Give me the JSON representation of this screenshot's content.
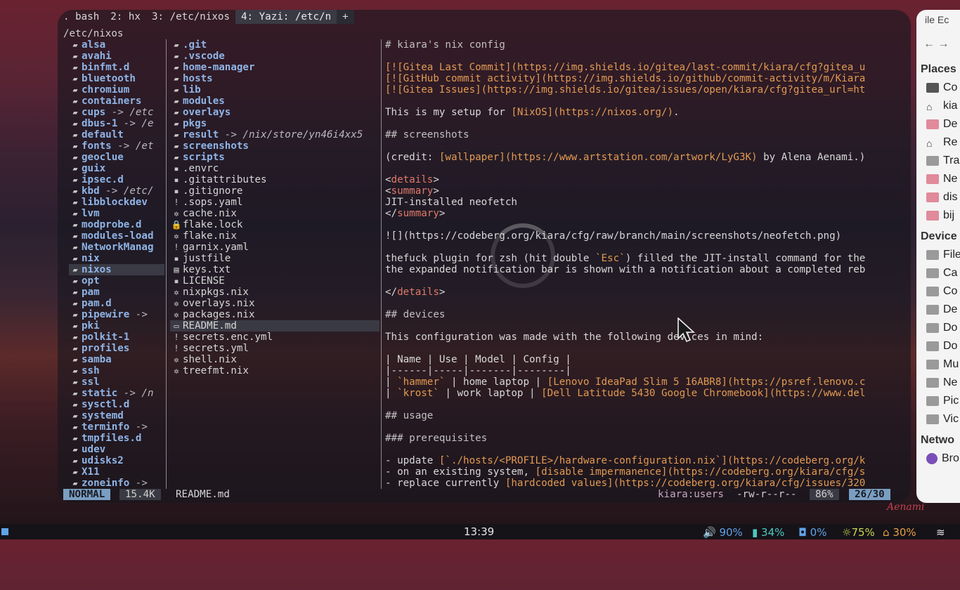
{
  "tabs": [
    {
      "label": ". bash"
    },
    {
      "label": "2: hx"
    },
    {
      "label": "3: /etc/nixos"
    },
    {
      "label": "4: Yazi: /etc/n"
    },
    {
      "label": "+"
    }
  ],
  "cwd": "/etc/nixos",
  "parent_entries": [
    {
      "name": "alsa",
      "type": "dir"
    },
    {
      "name": "avahi",
      "type": "dir"
    },
    {
      "name": "binfmt.d",
      "type": "dir"
    },
    {
      "name": "bluetooth",
      "type": "dir"
    },
    {
      "name": "chromium",
      "type": "dir"
    },
    {
      "name": "containers",
      "type": "dir"
    },
    {
      "name": "cups",
      "type": "link",
      "target": "-> /etc"
    },
    {
      "name": "dbus-1",
      "type": "link",
      "target": "-> /e"
    },
    {
      "name": "default",
      "type": "dir"
    },
    {
      "name": "fonts",
      "type": "link",
      "target": "-> /et"
    },
    {
      "name": "geoclue",
      "type": "dir"
    },
    {
      "name": "guix",
      "type": "dir"
    },
    {
      "name": "ipsec.d",
      "type": "dir"
    },
    {
      "name": "kbd",
      "type": "link",
      "target": "-> /etc/"
    },
    {
      "name": "libblockdev",
      "type": "dir"
    },
    {
      "name": "lvm",
      "type": "dir"
    },
    {
      "name": "modprobe.d",
      "type": "dir"
    },
    {
      "name": "modules-load",
      "type": "dir"
    },
    {
      "name": "NetworkManag",
      "type": "dir"
    },
    {
      "name": "nix",
      "type": "dir"
    },
    {
      "name": "nixos",
      "type": "dir",
      "selected": true
    },
    {
      "name": "opt",
      "type": "dir"
    },
    {
      "name": "pam",
      "type": "dir"
    },
    {
      "name": "pam.d",
      "type": "dir"
    },
    {
      "name": "pipewire",
      "type": "link",
      "target": "->"
    },
    {
      "name": "pki",
      "type": "dir"
    },
    {
      "name": "polkit-1",
      "type": "dir"
    },
    {
      "name": "profiles",
      "type": "dir"
    },
    {
      "name": "samba",
      "type": "dir"
    },
    {
      "name": "ssh",
      "type": "dir"
    },
    {
      "name": "ssl",
      "type": "dir"
    },
    {
      "name": "static",
      "type": "link",
      "target": "-> /n"
    },
    {
      "name": "sysctl.d",
      "type": "dir"
    },
    {
      "name": "systemd",
      "type": "dir"
    },
    {
      "name": "terminfo",
      "type": "link",
      "target": "->"
    },
    {
      "name": "tmpfiles.d",
      "type": "dir"
    },
    {
      "name": "udev",
      "type": "dir"
    },
    {
      "name": "udisks2",
      "type": "dir"
    },
    {
      "name": "X11",
      "type": "dir"
    },
    {
      "name": "zoneinfo",
      "type": "link",
      "target": "->"
    }
  ],
  "current_entries": [
    {
      "name": ".git",
      "type": "dir",
      "icon": "folder"
    },
    {
      "name": ".vscode",
      "type": "dir",
      "icon": "folder"
    },
    {
      "name": "home-manager",
      "type": "dir",
      "icon": "folder"
    },
    {
      "name": "hosts",
      "type": "dir",
      "icon": "folder"
    },
    {
      "name": "lib",
      "type": "dir",
      "icon": "folder"
    },
    {
      "name": "modules",
      "type": "dir",
      "icon": "folder"
    },
    {
      "name": "overlays",
      "type": "dir",
      "icon": "folder"
    },
    {
      "name": "pkgs",
      "type": "dir",
      "icon": "folder"
    },
    {
      "name": "result",
      "type": "link",
      "target": "-> /nix/store/yn46i4xx5",
      "icon": "folder"
    },
    {
      "name": "screenshots",
      "type": "dir",
      "icon": "folder"
    },
    {
      "name": "scripts",
      "type": "dir",
      "icon": "folder"
    },
    {
      "name": ".envrc",
      "type": "file",
      "icon": "file"
    },
    {
      "name": ".gitattributes",
      "type": "file",
      "icon": "file"
    },
    {
      "name": ".gitignore",
      "type": "file",
      "icon": "file"
    },
    {
      "name": ".sops.yaml",
      "type": "file",
      "icon": "!"
    },
    {
      "name": "cache.nix",
      "type": "file",
      "icon": "nix"
    },
    {
      "name": "flake.lock",
      "type": "file",
      "icon": "lock"
    },
    {
      "name": "flake.nix",
      "type": "file",
      "icon": "nix"
    },
    {
      "name": "garnix.yaml",
      "type": "file",
      "icon": "!"
    },
    {
      "name": "justfile",
      "type": "file",
      "icon": "file"
    },
    {
      "name": "keys.txt",
      "type": "file",
      "icon": "txt"
    },
    {
      "name": "LICENSE",
      "type": "file",
      "icon": "file"
    },
    {
      "name": "nixpkgs.nix",
      "type": "file",
      "icon": "nix"
    },
    {
      "name": "overlays.nix",
      "type": "file",
      "icon": "nix"
    },
    {
      "name": "packages.nix",
      "type": "file",
      "icon": "nix"
    },
    {
      "name": "README.md",
      "type": "file",
      "icon": "md",
      "selected": true
    },
    {
      "name": "secrets.enc.yml",
      "type": "file",
      "icon": "!"
    },
    {
      "name": "secrets.yml",
      "type": "file",
      "icon": "!"
    },
    {
      "name": "shell.nix",
      "type": "file",
      "icon": "nix"
    },
    {
      "name": "treefmt.nix",
      "type": "file",
      "icon": "nix"
    }
  ],
  "preview_lines": [
    [
      {
        "t": "# kiara's nix config",
        "c": "h"
      }
    ],
    [],
    [
      {
        "t": "[![Gitea Last Commit](https://img.shields.io/gitea/last-commit/kiara/cfg?gitea_u",
        "c": "o"
      }
    ],
    [
      {
        "t": "[![GitHub commit activity](https://img.shields.io/github/commit-activity/m/Kiara",
        "c": "o"
      }
    ],
    [
      {
        "t": "[![Gitea Issues](https://img.shields.io/gitea/issues/open/kiara/cfg?gitea_url=ht",
        "c": "o"
      }
    ],
    [],
    [
      {
        "t": "This is my setup for ",
        "c": "w"
      },
      {
        "t": "[NixOS](https://nixos.org/)",
        "c": "o"
      },
      {
        "t": ".",
        "c": "w"
      }
    ],
    [],
    [
      {
        "t": "## screenshots",
        "c": "h"
      }
    ],
    [],
    [
      {
        "t": "(credit: ",
        "c": "w"
      },
      {
        "t": "[wallpaper](https://www.artstation.com/artwork/LyG3K)",
        "c": "o"
      },
      {
        "t": " by Alena Aenami.)",
        "c": "w"
      }
    ],
    [],
    [
      {
        "t": "<",
        "c": "w"
      },
      {
        "t": "details",
        "c": "r"
      },
      {
        "t": ">",
        "c": "w"
      }
    ],
    [
      {
        "t": "<",
        "c": "w"
      },
      {
        "t": "summary",
        "c": "r"
      },
      {
        "t": ">",
        "c": "w"
      }
    ],
    [
      {
        "t": "JIT-installed neofetch",
        "c": "w"
      }
    ],
    [
      {
        "t": "</",
        "c": "w"
      },
      {
        "t": "summary",
        "c": "r"
      },
      {
        "t": ">",
        "c": "w"
      }
    ],
    [],
    [
      {
        "t": "![](https://codeberg.org/kiara/cfg/raw/branch/main/screenshots/neofetch.png)",
        "c": "w"
      }
    ],
    [],
    [
      {
        "t": "thefuck plugin for zsh (hit double ",
        "c": "w"
      },
      {
        "t": "`Esc`",
        "c": "o"
      },
      {
        "t": ") filled the JIT-install command for the",
        "c": "w"
      }
    ],
    [
      {
        "t": "the expanded notification bar is shown with a notification about a completed reb",
        "c": "w"
      }
    ],
    [],
    [
      {
        "t": "</",
        "c": "w"
      },
      {
        "t": "details",
        "c": "r"
      },
      {
        "t": ">",
        "c": "w"
      }
    ],
    [],
    [
      {
        "t": "## devices",
        "c": "h"
      }
    ],
    [],
    [
      {
        "t": "This configuration was made with the following devices in mind:",
        "c": "w"
      }
    ],
    [],
    [
      {
        "t": "| Name | Use | Model | Config |",
        "c": "w"
      }
    ],
    [
      {
        "t": "|------|-----|-------|--------|",
        "c": "w"
      }
    ],
    [
      {
        "t": "| ",
        "c": "w"
      },
      {
        "t": "`hammer`",
        "c": "o"
      },
      {
        "t": " | home laptop | ",
        "c": "w"
      },
      {
        "t": "[Lenovo IdeaPad Slim 5 16ABR8](https://psref.lenovo.c",
        "c": "o"
      }
    ],
    [
      {
        "t": "| ",
        "c": "w"
      },
      {
        "t": "`krost`",
        "c": "o"
      },
      {
        "t": " | work laptop | ",
        "c": "w"
      },
      {
        "t": "[Dell Latitude 5430 Google Chromebook](https://www.del",
        "c": "o"
      }
    ],
    [],
    [
      {
        "t": "## usage",
        "c": "h"
      }
    ],
    [],
    [
      {
        "t": "### prerequisites",
        "c": "h"
      }
    ],
    [],
    [
      {
        "t": "- update ",
        "c": "w"
      },
      {
        "t": "[`./hosts/<PROFILE>/hardware-configuration.nix`](https://codeberg.org/k",
        "c": "o"
      }
    ],
    [
      {
        "t": "- on an existing system, ",
        "c": "w"
      },
      {
        "t": "[disable impermanence](https://codeberg.org/kiara/cfg/s",
        "c": "o"
      }
    ],
    [
      {
        "t": "- replace currently ",
        "c": "w"
      },
      {
        "t": "[hardcoded values](https://codeberg.org/kiara/cfg/issues/320",
        "c": "o"
      }
    ]
  ],
  "status": {
    "mode": "NORMAL",
    "size": "15.4K",
    "filename": "README.md",
    "owner": "kiara:users",
    "perms": "-rw-r--r--",
    "percent": "86%",
    "position": "26/30"
  },
  "file_manager": {
    "menu": "ile  Ec",
    "places_header": "Places",
    "places": [
      {
        "label": "Co",
        "icon": "dark"
      },
      {
        "label": "kia",
        "icon": "home"
      },
      {
        "label": "De",
        "icon": "folder"
      },
      {
        "label": "Re",
        "icon": "home"
      },
      {
        "label": "Tra",
        "icon": "drive"
      },
      {
        "label": "Ne",
        "icon": "folder"
      },
      {
        "label": "dis",
        "icon": "folder"
      },
      {
        "label": "bij",
        "icon": "folder"
      }
    ],
    "devices_header": "Device",
    "devices": [
      {
        "label": "File",
        "icon": "drive"
      },
      {
        "label": "Ca",
        "icon": "drive"
      },
      {
        "label": "Co",
        "icon": "drive"
      },
      {
        "label": "De",
        "icon": "drive"
      },
      {
        "label": "Do",
        "icon": "drive"
      },
      {
        "label": "Do",
        "icon": "drive"
      },
      {
        "label": "Mu",
        "icon": "drive"
      },
      {
        "label": "Ne",
        "icon": "drive"
      },
      {
        "label": "Pic",
        "icon": "drive"
      },
      {
        "label": "Vic",
        "icon": "drive"
      }
    ],
    "network_header": "Netwo",
    "network": [
      {
        "label": "Bro",
        "icon": "globe"
      }
    ]
  },
  "panel": {
    "clock": "13:39",
    "volume": "90%",
    "battery": "34%",
    "cpu": "0%",
    "brightness": "75%",
    "memory": "30%"
  },
  "signature": "Aenami",
  "colors": {
    "accent": "#7a9ec2",
    "dir": "#8fb4e6",
    "link_orange": "#e29a52",
    "tag_red": "#e07a6a"
  }
}
